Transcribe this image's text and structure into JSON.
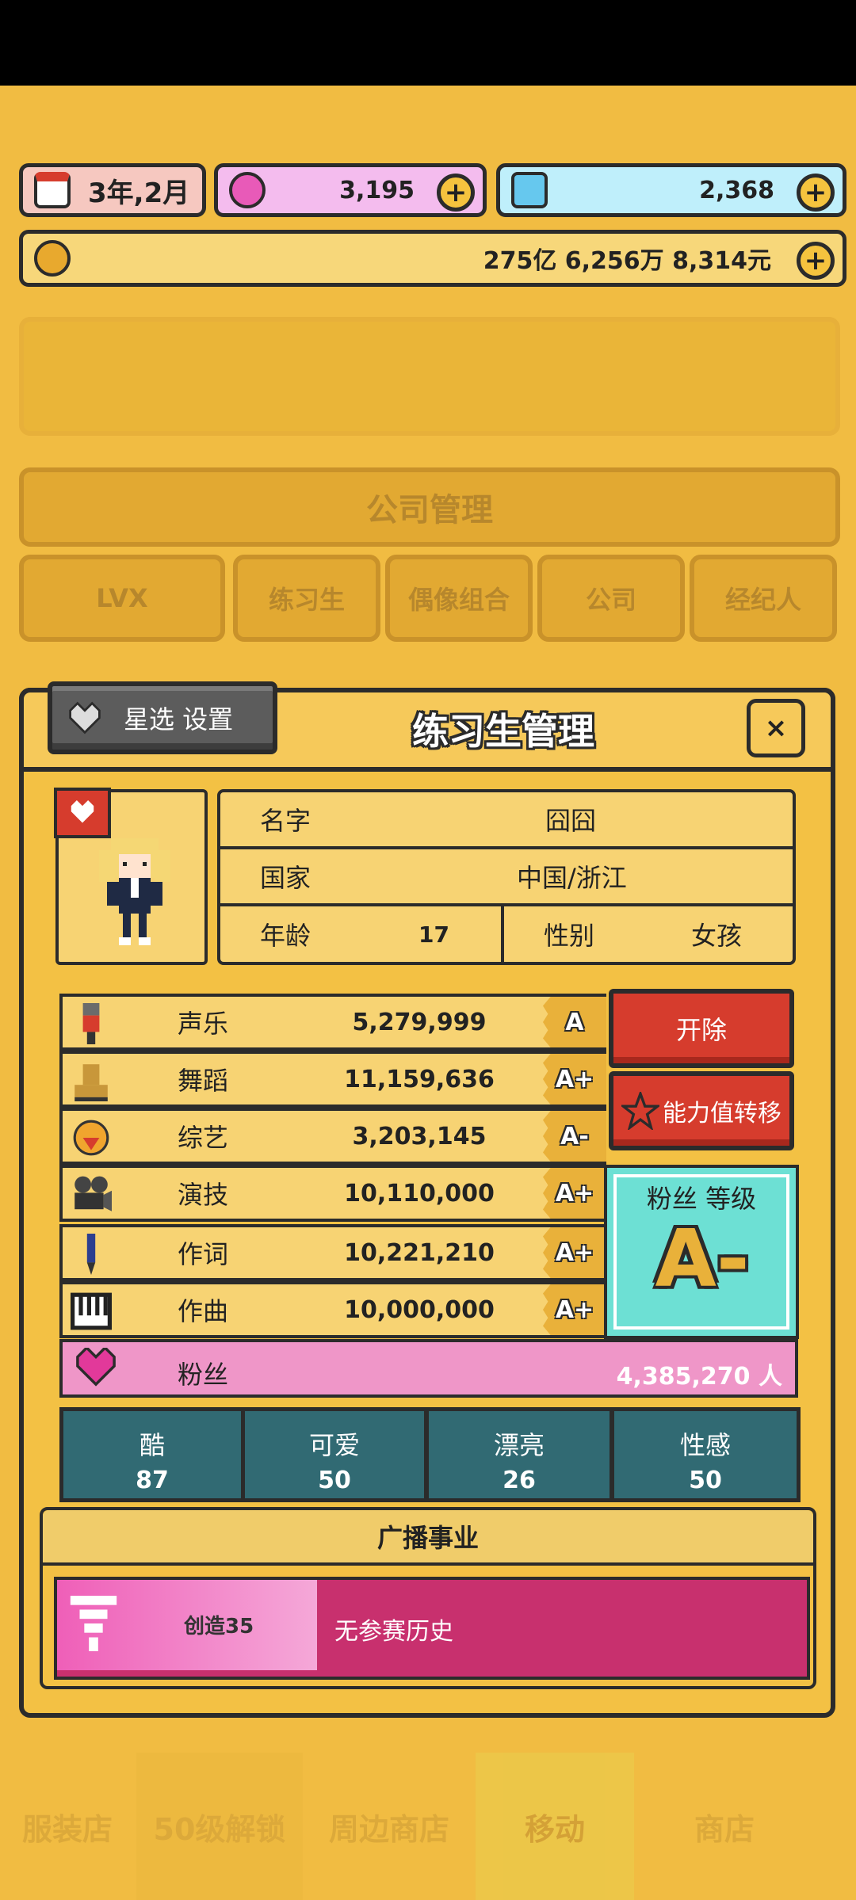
{
  "top": {
    "date": "3年,2月",
    "pink_currency": "3,195",
    "blue_currency": "2,368",
    "money": "275亿 6,256万 8,314元"
  },
  "background": {
    "dialog_title": "公司管理",
    "tabs": [
      "LVX",
      "练习生",
      "偶像组合",
      "公司",
      "经纪人"
    ],
    "bottom_nav": [
      "服装店",
      "50级解锁",
      "周边商店",
      "移动",
      "商店"
    ]
  },
  "panel": {
    "title": "练习生管理",
    "close": "×",
    "star_button": "星选 设置",
    "profile": {
      "name_label": "名字",
      "name": "囧囧",
      "country_label": "国家",
      "country": "中国/浙江",
      "age_label": "年龄",
      "age": "17",
      "gender_label": "性别",
      "gender": "女孩"
    },
    "stats": [
      {
        "label": "声乐",
        "value": "5,279,999",
        "grade": "A",
        "icon": "microphone-icon"
      },
      {
        "label": "舞蹈",
        "value": "11,159,636",
        "grade": "A+",
        "icon": "boot-icon"
      },
      {
        "label": "综艺",
        "value": "3,203,145",
        "grade": "A-",
        "icon": "laugh-icon"
      },
      {
        "label": "演技",
        "value": "10,110,000",
        "grade": "A+",
        "icon": "camera-icon"
      },
      {
        "label": "作词",
        "value": "10,221,210",
        "grade": "A+",
        "icon": "pen-icon"
      },
      {
        "label": "作曲",
        "value": "10,000,000",
        "grade": "A+",
        "icon": "piano-icon"
      }
    ],
    "fans": {
      "label": "粉丝",
      "value": "4,385,270 人"
    },
    "dismiss_button": "开除",
    "transfer_button": "能力值转移",
    "fan_level": {
      "label": "粉丝 等级",
      "grade": "A-"
    },
    "attributes": [
      {
        "name": "酷",
        "value": "87"
      },
      {
        "name": "可爱",
        "value": "50"
      },
      {
        "name": "漂亮",
        "value": "26"
      },
      {
        "name": "性感",
        "value": "50"
      }
    ],
    "broadcast": {
      "title": "广播事业",
      "show": "创造35",
      "history": "无参赛历史"
    }
  },
  "colors": {
    "background": "#f1bc42",
    "red": "#d63c2d",
    "teal": "#316a73",
    "fans_pink": "#ef96c8",
    "broadcast_magenta": "#c8306e"
  }
}
